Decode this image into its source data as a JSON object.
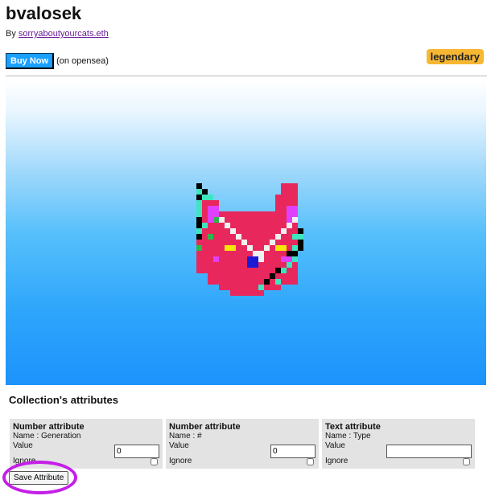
{
  "item": {
    "name": "bvalosek",
    "by_prefix": "By",
    "creator": "sorryaboutyourcats.eth",
    "buy_label": "Buy Now",
    "buy_note": "(on opensea)",
    "rarity": "legendary"
  },
  "colors": {
    "buy_button": "#1aa0ff",
    "rarity_badge": "#f7b733",
    "highlight_ring": "#c51ee8",
    "cat_body": "#e8285c",
    "cat_stripe": "#3ee6c0",
    "cat_ear": "#e040fb",
    "cat_eye": "#f5e60a",
    "cat_nose": "#1a1ad6",
    "cat_outline": "#000000",
    "cat_highlight": "#f0f0f0",
    "cat_spot": "#2bb84a"
  },
  "attributes": {
    "section_title": "Collection's attributes",
    "items": [
      {
        "type": "Number attribute",
        "name": "Name : Generation",
        "value_label": "Value",
        "value": "0",
        "ignore_label": "Ignore"
      },
      {
        "type": "Number attribute",
        "name": "Name : #",
        "value_label": "Value",
        "value": "0",
        "ignore_label": "Ignore"
      },
      {
        "type": "Text attribute",
        "name": "Name : Type",
        "value_label": "Value",
        "value": "",
        "ignore_label": "Ignore"
      }
    ],
    "save_label": "Save Attribute"
  }
}
